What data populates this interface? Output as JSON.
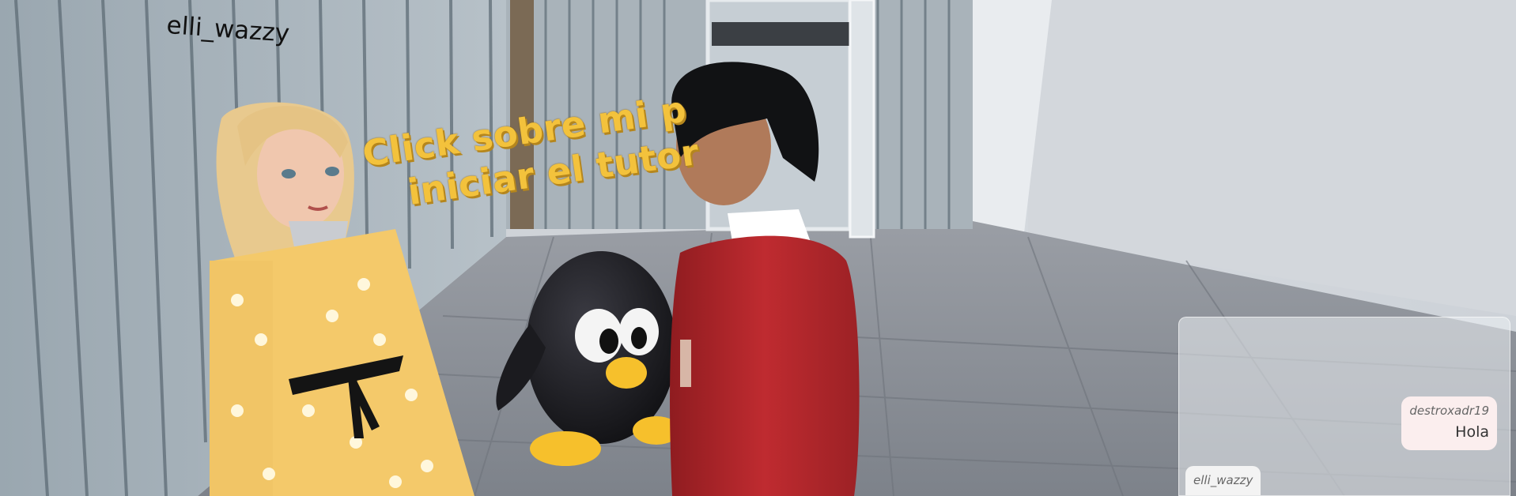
{
  "player_nametag": "elli_wazzy",
  "tutorial_sign": {
    "line1": "Click sobre mi p",
    "line2": "iniciar el tutor",
    "color": "#f3c23c"
  },
  "chat": {
    "messages": [
      {
        "sender": "destroxadr19",
        "text": "Hola",
        "side": "remote"
      }
    ],
    "self_sender": "elli_wazzy"
  },
  "colors": {
    "wall": "#aab4bc",
    "floor": "#8e939b",
    "jacket_red": "#b3262b",
    "coat_yellow": "#f4c96a",
    "penguin_black": "#1b1b1f",
    "penguin_beak": "#f6c02c"
  }
}
